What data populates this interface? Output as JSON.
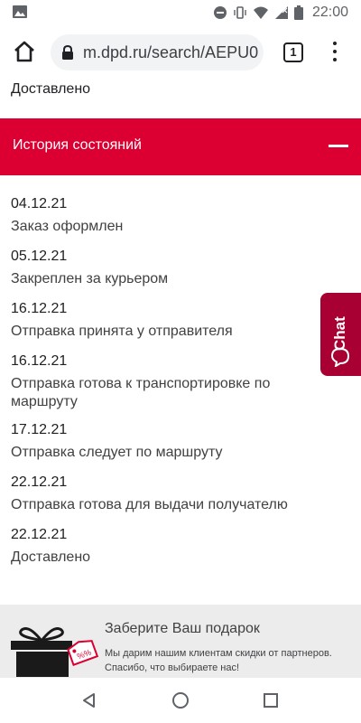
{
  "status_bar": {
    "time": "22:00",
    "icons": [
      "image-icon",
      "do-not-disturb-icon",
      "vibrate-icon",
      "wifi-icon",
      "signal-icon",
      "battery-icon"
    ]
  },
  "browser": {
    "url": "m.dpd.ru/search/AEPU0",
    "tab_count": "1",
    "icons": [
      "home-icon",
      "lock-icon",
      "menu-dots-icon"
    ]
  },
  "page": {
    "current_status": "Доставлено",
    "history_title": "История состояний",
    "events": [
      {
        "date": "04.12.21",
        "status": "Заказ оформлен"
      },
      {
        "date": "05.12.21",
        "status": "Закреплен за курьером"
      },
      {
        "date": "16.12.21",
        "status": "Отправка принята у отправителя"
      },
      {
        "date": "16.12.21",
        "status": "Отправка готова к транспортировке по маршруту"
      },
      {
        "date": "17.12.21",
        "status": "Отправка следует по маршруту"
      },
      {
        "date": "22.12.21",
        "status": "Отправка готова для выдачи получателю"
      },
      {
        "date": "22.12.21",
        "status": "Доставлено"
      }
    ]
  },
  "chat": {
    "label": "Chat"
  },
  "promo": {
    "title": "Заберите Ваш подарок",
    "text": "Мы дарим нашим клиентам скидки от партнеров. Спасибо, что выбираете нас!",
    "tag_text": "%%"
  },
  "colors": {
    "brand_red": "#dc0032",
    "chat_red": "#a90034",
    "promo_bg": "#ececed"
  }
}
